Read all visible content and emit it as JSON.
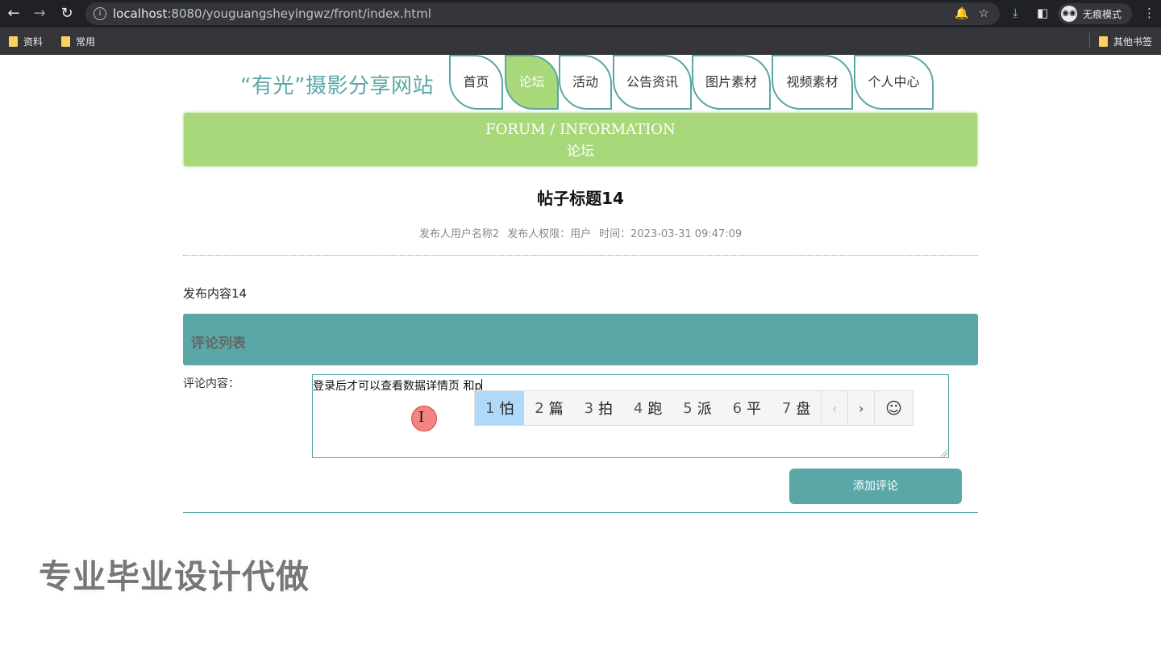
{
  "browser": {
    "url_host": "localhost",
    "url_rest": ":8080/youguangsheyingwz/front/index.html",
    "incognito_label": "无痕模式",
    "bookmarks": [
      "资料",
      "常用"
    ],
    "other_bookmarks": "其他书签"
  },
  "site": {
    "logo": "“有光”摄影分享网站",
    "nav": [
      {
        "label": "首页",
        "active": false
      },
      {
        "label": "论坛",
        "active": true
      },
      {
        "label": "活动",
        "active": false
      },
      {
        "label": "公告资讯",
        "active": false
      },
      {
        "label": "图片素材",
        "active": false
      },
      {
        "label": "视频素材",
        "active": false
      },
      {
        "label": "个人中心",
        "active": false
      }
    ]
  },
  "banner": {
    "en": "FORUM / INFORMATION",
    "cn": "论坛"
  },
  "post": {
    "title": "帖子标题14",
    "publisher": "发布人用户名称2",
    "permission": "发布人权限：用户",
    "time": "时间：2023-03-31 09:47:09",
    "content": "发布内容14"
  },
  "comments": {
    "header": "评论列表",
    "label": "评论内容：",
    "input_value": "登录后才可以查看数据详情页 和p",
    "submit_label": "添加评论"
  },
  "ime": {
    "candidates": [
      {
        "num": "1",
        "char": "怕"
      },
      {
        "num": "2",
        "char": "篇"
      },
      {
        "num": "3",
        "char": "拍"
      },
      {
        "num": "4",
        "char": "跑"
      },
      {
        "num": "5",
        "char": "派"
      },
      {
        "num": "6",
        "char": "平"
      },
      {
        "num": "7",
        "char": "盘"
      }
    ],
    "prev": "‹",
    "next": "›",
    "emoji": "☺"
  },
  "watermark": "专业毕业设计代做",
  "colors": {
    "accent": "#5ba6a7",
    "green": "#a8d87a"
  }
}
